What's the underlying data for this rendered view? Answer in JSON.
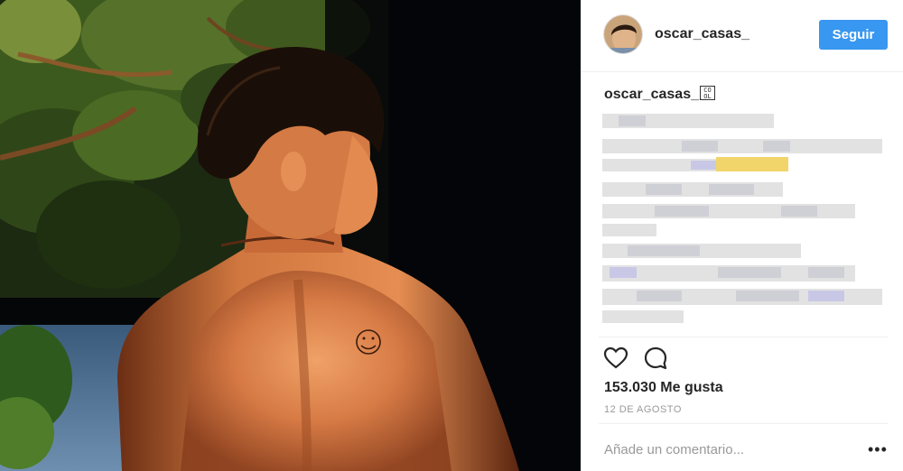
{
  "post": {
    "username": "oscar_casas_",
    "follow_label": "Seguir",
    "caption_username": "oscar_casas_",
    "caption_emoji": "🆒",
    "likes_text": "153.030 Me gusta",
    "date_text": "12 DE AGOSTO",
    "comment_placeholder": "Añade un comentario...",
    "more_label": "•••"
  },
  "colors": {
    "accent": "#3897f0",
    "text": "#262626",
    "muted": "#999999",
    "divider": "#efefef"
  },
  "icons": [
    "heart-icon",
    "comment-icon",
    "more-options-icon"
  ]
}
